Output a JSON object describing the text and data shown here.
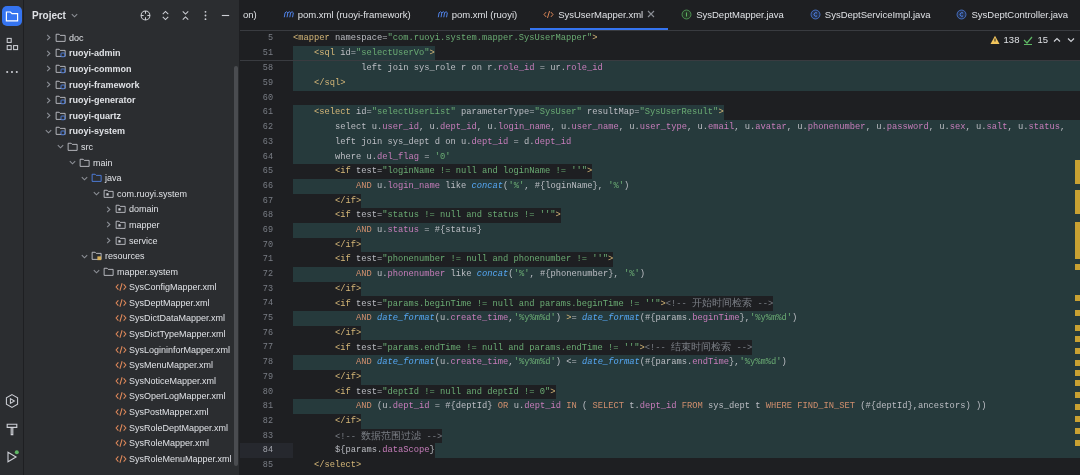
{
  "tool_strip": {
    "top": [
      {
        "kind": "project",
        "selected": true
      },
      {
        "kind": "structure",
        "selected": false
      },
      {
        "kind": "more",
        "selected": false
      }
    ],
    "bottom": [
      {
        "kind": "services",
        "selected": false
      },
      {
        "kind": "build",
        "selected": false
      },
      {
        "kind": "run",
        "selected": false
      }
    ]
  },
  "project_panel": {
    "title": "Project",
    "tree": [
      {
        "name": "doc",
        "kind": "folder",
        "expanded": false
      },
      {
        "name": "ruoyi-admin",
        "kind": "module",
        "expanded": false
      },
      {
        "name": "ruoyi-common",
        "kind": "module",
        "expanded": false
      },
      {
        "name": "ruoyi-framework",
        "kind": "module",
        "expanded": false
      },
      {
        "name": "ruoyi-generator",
        "kind": "module",
        "expanded": false
      },
      {
        "name": "ruoyi-quartz",
        "kind": "module",
        "expanded": false
      },
      {
        "name": "ruoyi-system",
        "kind": "module",
        "expanded": true,
        "children": [
          {
            "name": "src",
            "kind": "folder",
            "expanded": true,
            "children": [
              {
                "name": "main",
                "kind": "folder",
                "expanded": true,
                "children": [
                  {
                    "name": "java",
                    "kind": "source",
                    "expanded": true,
                    "children": [
                      {
                        "name": "com.ruoyi.system",
                        "kind": "package",
                        "expanded": true,
                        "children": [
                          {
                            "name": "domain",
                            "kind": "package",
                            "expanded": false
                          },
                          {
                            "name": "mapper",
                            "kind": "package",
                            "expanded": false
                          },
                          {
                            "name": "service",
                            "kind": "package",
                            "expanded": false
                          }
                        ]
                      }
                    ]
                  },
                  {
                    "name": "resources",
                    "kind": "resources",
                    "expanded": true,
                    "children": [
                      {
                        "name": "mapper.system",
                        "kind": "folder",
                        "expanded": true,
                        "children": [
                          {
                            "name": "SysConfigMapper.xml",
                            "kind": "xml"
                          },
                          {
                            "name": "SysDeptMapper.xml",
                            "kind": "xml"
                          },
                          {
                            "name": "SysDictDataMapper.xml",
                            "kind": "xml"
                          },
                          {
                            "name": "SysDictTypeMapper.xml",
                            "kind": "xml"
                          },
                          {
                            "name": "SysLogininforMapper.xml",
                            "kind": "xml"
                          },
                          {
                            "name": "SysMenuMapper.xml",
                            "kind": "xml"
                          },
                          {
                            "name": "SysNoticeMapper.xml",
                            "kind": "xml"
                          },
                          {
                            "name": "SysOperLogMapper.xml",
                            "kind": "xml"
                          },
                          {
                            "name": "SysPostMapper.xml",
                            "kind": "xml"
                          },
                          {
                            "name": "SysRoleDeptMapper.xml",
                            "kind": "xml"
                          },
                          {
                            "name": "SysRoleMapper.xml",
                            "kind": "xml"
                          },
                          {
                            "name": "SysRoleMenuMapper.xml",
                            "kind": "xml"
                          }
                        ]
                      }
                    ]
                  }
                ]
              }
            ]
          }
        ]
      }
    ]
  },
  "tabs": [
    {
      "label": "on)",
      "kind": "cut",
      "selected": false
    },
    {
      "label": "pom.xml (ruoyi-framework)",
      "kind": "maven",
      "selected": false
    },
    {
      "label": "pom.xml (ruoyi)",
      "kind": "maven",
      "selected": false
    },
    {
      "label": "SysUserMapper.xml",
      "kind": "xml",
      "selected": true
    },
    {
      "label": "SysDeptMapper.java",
      "kind": "interface",
      "selected": false
    },
    {
      "label": "SysDeptServiceImpl.java",
      "kind": "class",
      "selected": false
    },
    {
      "label": "SysDeptController.java",
      "kind": "class",
      "selected": false
    }
  ],
  "inspections": {
    "warnings": "138",
    "weak_warnings": "15"
  },
  "sticky_lines": [
    {
      "number": "5",
      "text": "<mapper namespace=\"com.ruoyi.system.mapper.SysUserMapper\">",
      "highlighted": false,
      "boxed": false
    },
    {
      "number": "51",
      "text": "    <sql id=\"selectUserVo\">",
      "highlighted": false,
      "boxed": true
    }
  ],
  "lines": [
    {
      "number": "58",
      "text": "             left join sys_role r on r.role_id = ur.role_id",
      "highlighted": true,
      "boxed": false,
      "current": false
    },
    {
      "number": "59",
      "text": "    </sql>",
      "highlighted": true,
      "boxed": false,
      "current": false
    },
    {
      "number": "60",
      "highlighted": false,
      "current": false
    },
    {
      "number": "61",
      "text": "    <select id=\"selectUserList\" parameterType=\"SysUser\" resultMap=\"SysUserResult\">",
      "highlighted": false,
      "boxed": true,
      "current": false
    },
    {
      "number": "62",
      "text": "        select u.user_id, u.dept_id, u.login_name, u.user_name, u.user_type, u.email, u.avatar, u.phonenumber, u.password, u.sex, u.salt, u.status,",
      "highlighted": true,
      "boxed": false,
      "current": false
    },
    {
      "number": "63",
      "text": "        left join sys_dept d on u.dept_id = d.dept_id",
      "highlighted": true,
      "boxed": false,
      "current": false
    },
    {
      "number": "64",
      "text": "        where u.del_flag = '0'",
      "highlighted": true,
      "boxed": false,
      "current": false
    },
    {
      "number": "65",
      "text": "        <if test=\"loginName != null and loginName != ''\">",
      "highlighted": true,
      "boxed": true,
      "current": false
    },
    {
      "number": "66",
      "text": "            AND u.login_name like concat('%', #{loginName}, '%')",
      "highlighted": true,
      "boxed": false,
      "current": false
    },
    {
      "number": "67",
      "text": "        </if>",
      "highlighted": true,
      "boxed": true,
      "current": false
    },
    {
      "number": "68",
      "text": "        <if test=\"status != null and status != ''\">",
      "highlighted": true,
      "boxed": true,
      "current": false
    },
    {
      "number": "69",
      "text": "            AND u.status = #{status}",
      "highlighted": true,
      "boxed": false,
      "current": false
    },
    {
      "number": "70",
      "text": "        </if>",
      "highlighted": true,
      "boxed": true,
      "current": false
    },
    {
      "number": "71",
      "text": "        <if test=\"phonenumber != null and phonenumber != ''\">",
      "highlighted": true,
      "boxed": true,
      "current": false
    },
    {
      "number": "72",
      "text": "            AND u.phonenumber like concat('%', #{phonenumber}, '%')",
      "highlighted": true,
      "boxed": false,
      "current": false
    },
    {
      "number": "73",
      "text": "        </if>",
      "highlighted": true,
      "boxed": true,
      "current": false
    },
    {
      "number": "74",
      "text": "        <if test=\"params.beginTime != null and params.beginTime != ''\"><!-- 开始时间检索 -->",
      "highlighted": true,
      "boxed": true,
      "current": false
    },
    {
      "number": "75",
      "text": "            AND date_format(u.create_time,'%y%m%d') >= date_format(#{params.beginTime},'%y%m%d')",
      "highlighted": true,
      "boxed": false,
      "current": false
    },
    {
      "number": "76",
      "text": "        </if>",
      "highlighted": true,
      "boxed": true,
      "current": false
    },
    {
      "number": "77",
      "text": "        <if test=\"params.endTime != null and params.endTime != ''\"><!-- 结束时间检索 -->",
      "highlighted": true,
      "boxed": true,
      "current": false
    },
    {
      "number": "78",
      "text": "            AND date_format(u.create_time,'%y%m%d') <= date_format(#{params.endTime},'%y%m%d')",
      "highlighted": true,
      "boxed": false,
      "current": false
    },
    {
      "number": "79",
      "text": "        </if>",
      "highlighted": true,
      "boxed": true,
      "current": false
    },
    {
      "number": "80",
      "text": "        <if test=\"deptId != null and deptId != 0\">",
      "highlighted": true,
      "boxed": true,
      "current": false
    },
    {
      "number": "81",
      "text": "            AND (u.dept_id = #{deptId} OR u.dept_id IN ( SELECT t.dept_id FROM sys_dept t WHERE FIND_IN_SET (#{deptId},ancestors) ))",
      "highlighted": true,
      "boxed": false,
      "current": false
    },
    {
      "number": "82",
      "text": "        </if>",
      "highlighted": true,
      "boxed": true,
      "current": false
    },
    {
      "number": "83",
      "text": "        <!-- 数据范围过滤 -->",
      "highlighted": true,
      "boxed": true,
      "current": false
    },
    {
      "number": "84",
      "text": "        ${params.dataScope}",
      "highlighted": true,
      "boxed": true,
      "current": true
    },
    {
      "number": "85",
      "text": "    </select>",
      "highlighted": false,
      "boxed": false,
      "current": false
    }
  ]
}
